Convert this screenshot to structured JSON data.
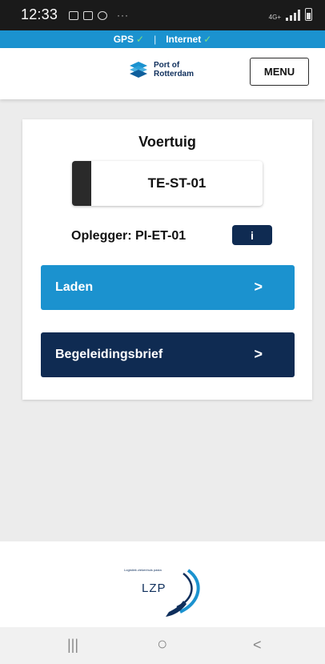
{
  "status_bar": {
    "time": "12:33",
    "network_label": "4G+",
    "notification_icons": [
      "gallery-icon",
      "chat-icon",
      "settings-icon",
      "more-icon"
    ]
  },
  "connection_bar": {
    "gps_label": "GPS",
    "separator": "|",
    "internet_label": "Internet",
    "check": "✓",
    "gps_ok": true,
    "internet_ok": true
  },
  "header": {
    "logo_line1": "Port of",
    "logo_line2": "Rotterdam",
    "menu_label": "MENU"
  },
  "card": {
    "title": "Voertuig",
    "vehicle_plate": "TE-ST-01",
    "trailer_text": "Oplegger: PI-ET-01",
    "info_label": "i",
    "actions": [
      {
        "label": "Laden",
        "chevron": ">"
      },
      {
        "label": "Begeleidingsbrief",
        "chevron": ">"
      }
    ]
  },
  "footer": {
    "tagline": "Logistiek ziekenhuis pasta",
    "logo_text": "LZP"
  },
  "nav_bar": {
    "recents": "|||",
    "home": "○",
    "back": "<"
  },
  "colors": {
    "accent_blue": "#1b92cf",
    "navy": "#0f2b52",
    "check_green": "#7fe07f"
  }
}
